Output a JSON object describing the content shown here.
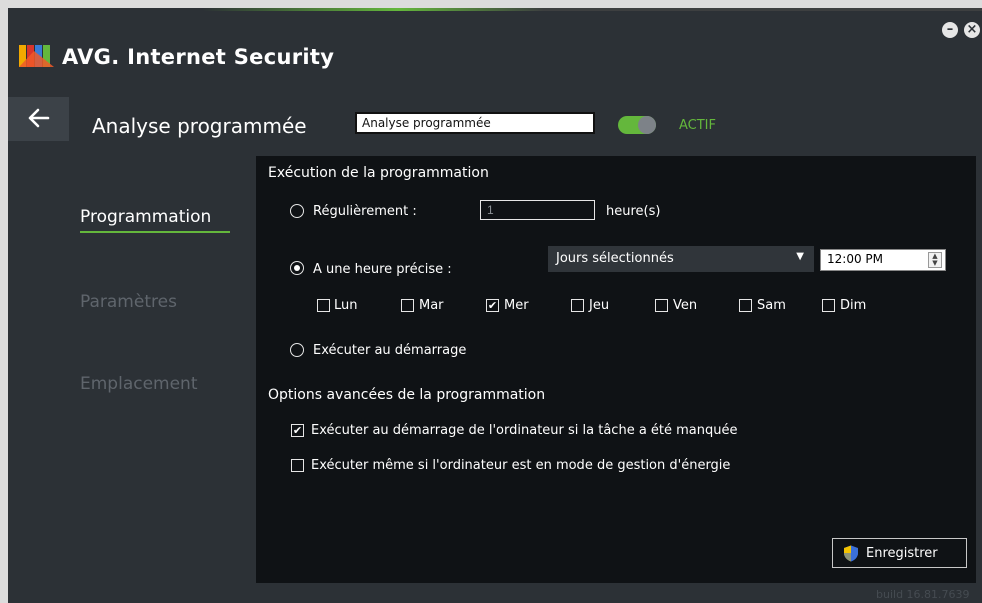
{
  "app": {
    "title": "AVG. Internet Security",
    "build": "build 16.81.7639"
  },
  "window": {
    "minimize_glyph": "–",
    "close_glyph": "×"
  },
  "header": {
    "back_icon": "arrow-left-icon",
    "page_title": "Analyse programmée",
    "name_value": "Analyse programmée",
    "toggle_state": true,
    "toggle_label": "ACTIF"
  },
  "nav": {
    "items": [
      {
        "label": "Programmation",
        "active": true
      },
      {
        "label": "Paramètres",
        "active": false
      },
      {
        "label": "Emplacement",
        "active": false
      }
    ]
  },
  "schedule": {
    "section_title": "Exécution de la programmation",
    "regular": {
      "label": "Régulièrement :",
      "selected": false,
      "hours_value": "1",
      "unit": "heure(s)"
    },
    "precise": {
      "label": "A une heure précise :",
      "selected": true,
      "days_select": "Jours sélectionnés",
      "time_value": "12:00 PM"
    },
    "days": [
      {
        "label": "Lun",
        "checked": false
      },
      {
        "label": "Mar",
        "checked": false
      },
      {
        "label": "Mer",
        "checked": true
      },
      {
        "label": "Jeu",
        "checked": false
      },
      {
        "label": "Ven",
        "checked": false
      },
      {
        "label": "Sam",
        "checked": false
      },
      {
        "label": "Dim",
        "checked": false
      }
    ],
    "startup": {
      "label": "Exécuter au démarrage",
      "selected": false
    }
  },
  "advanced": {
    "section_title": "Options avancées de la programmation",
    "options": [
      {
        "label": "Exécuter au démarrage de l'ordinateur si la tâche a été manquée",
        "checked": true
      },
      {
        "label": "Exécuter même si l'ordinateur est en mode de gestion d'énergie",
        "checked": false
      }
    ]
  },
  "footer": {
    "save_label": "Enregistrer",
    "save_icon": "uac-shield-icon"
  },
  "colors": {
    "accent": "#64b73c",
    "background": "#2c3136",
    "panel": "#0f1215"
  }
}
